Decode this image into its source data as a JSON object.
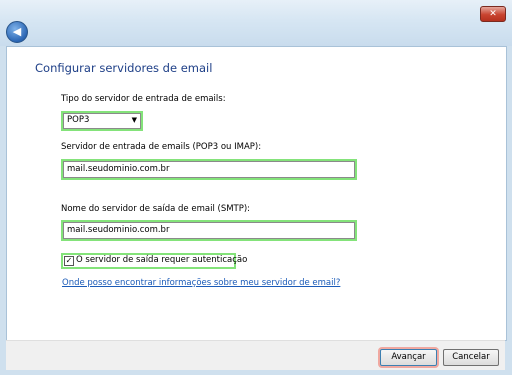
{
  "window": {
    "close_glyph": "✕",
    "back_glyph": "◀"
  },
  "dialog": {
    "title": "Configurar servidores de email",
    "incoming_type_label": "Tipo do servidor de entrada de emails:",
    "incoming_type_value": "POP3",
    "incoming_server_label": "Servidor de entrada de emails (POP3 ou IMAP):",
    "incoming_server_value": "mail.seudominio.com.br",
    "outgoing_server_label": "Nome do servidor de saída de email (SMTP):",
    "outgoing_server_value": "mail.seudominio.com.br",
    "auth_checkbox_label": "O servidor de saída requer autenticação",
    "auth_checked": true,
    "help_link": "Onde posso encontrar informações sobre meu servidor de email?"
  },
  "footer": {
    "next_label": "Avançar",
    "cancel_label": "Cancelar"
  }
}
